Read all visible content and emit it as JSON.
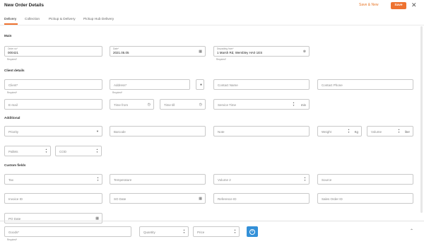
{
  "header": {
    "title": "New Order Details",
    "save_new_label": "Save & New",
    "save_label": "Save",
    "close_icon": "close-icon"
  },
  "tabs": [
    {
      "label": "Delivery",
      "active": true
    },
    {
      "label": "Collection",
      "active": false
    },
    {
      "label": "Pickup & Delivery",
      "active": false
    },
    {
      "label": "Pickup Hub Delivery",
      "active": false
    }
  ],
  "main": {
    "section_title": "Main",
    "order_no": {
      "label": "Order no*",
      "value": "000421",
      "helper": "Required*"
    },
    "date": {
      "label": "Date*",
      "value": "2021.05.05"
    },
    "depot": {
      "label": "Depositing from*",
      "value": "1 Marsh Rd, Wembley HA0 1ES",
      "helper": "Required*"
    }
  },
  "client": {
    "section_title": "Client details",
    "client": {
      "placeholder": "Client*",
      "helper": "Required*"
    },
    "address": {
      "placeholder": "Address*",
      "helper": "Required*"
    },
    "contact_name": {
      "placeholder": "Contact Name"
    },
    "contact_phone": {
      "placeholder": "Contact Phone"
    },
    "email": {
      "placeholder": "E-mail"
    },
    "time_from": {
      "placeholder": "Time from"
    },
    "time_till": {
      "placeholder": "Time till"
    },
    "service_time": {
      "placeholder": "Service Time",
      "unit": "min"
    }
  },
  "additional": {
    "section_title": "Additional",
    "priority": {
      "placeholder": "Priority"
    },
    "barcode": {
      "placeholder": "Barcode"
    },
    "note": {
      "placeholder": "Note"
    },
    "weight": {
      "placeholder": "Weight",
      "unit": "Kg"
    },
    "volume": {
      "placeholder": "Volume",
      "unit": "liter"
    },
    "pallets": {
      "placeholder": "Pallets"
    },
    "cod": {
      "placeholder": "COD"
    }
  },
  "custom": {
    "section_title": "Custom fields",
    "tax": {
      "placeholder": "Tax"
    },
    "temperature": {
      "placeholder": "Temperature"
    },
    "volume2": {
      "placeholder": "Volume 2"
    },
    "source": {
      "placeholder": "Source"
    },
    "invoice_id": {
      "placeholder": "Invoice ID"
    },
    "so_date": {
      "placeholder": "SO Date"
    },
    "reference_id": {
      "placeholder": "Reference ID"
    },
    "sales_order_id": {
      "placeholder": "Sales Order ID"
    },
    "po_date": {
      "placeholder": "PO Date"
    }
  },
  "goods": {
    "goods": {
      "placeholder": "Goods*",
      "helper": "Required*"
    },
    "quantity": {
      "placeholder": "Quantity"
    },
    "price": {
      "placeholder": "Price"
    }
  },
  "colors": {
    "accent": "#ee7230",
    "primary_button": "#3390d8",
    "border": "#c9c9c9"
  }
}
